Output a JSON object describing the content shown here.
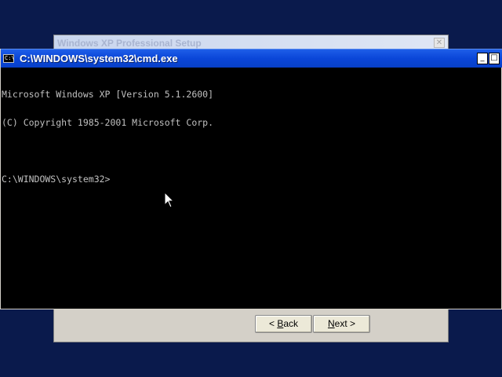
{
  "setup_dialog": {
    "title": "Windows XP Professional Setup",
    "close_label": "✕",
    "back_mnemonic": "B",
    "back_rest": "ack",
    "back_prefix": "< ",
    "next_mnemonic": "N",
    "next_rest": "ext >"
  },
  "console": {
    "icon_label": "C:\\",
    "title": "C:\\WINDOWS\\system32\\cmd.exe",
    "minimize_label": "_",
    "maximize_label": "□",
    "lines": [
      "Microsoft Windows XP [Version 5.1.2600]",
      "(C) Copyright 1985-2001 Microsoft Corp.",
      "",
      "C:\\WINDOWS\\system32>"
    ]
  },
  "colors": {
    "desktop": "#0a1a4c",
    "console_bg": "#000000",
    "console_text": "#c0c0c0",
    "titlebar": "#0a46d8"
  }
}
